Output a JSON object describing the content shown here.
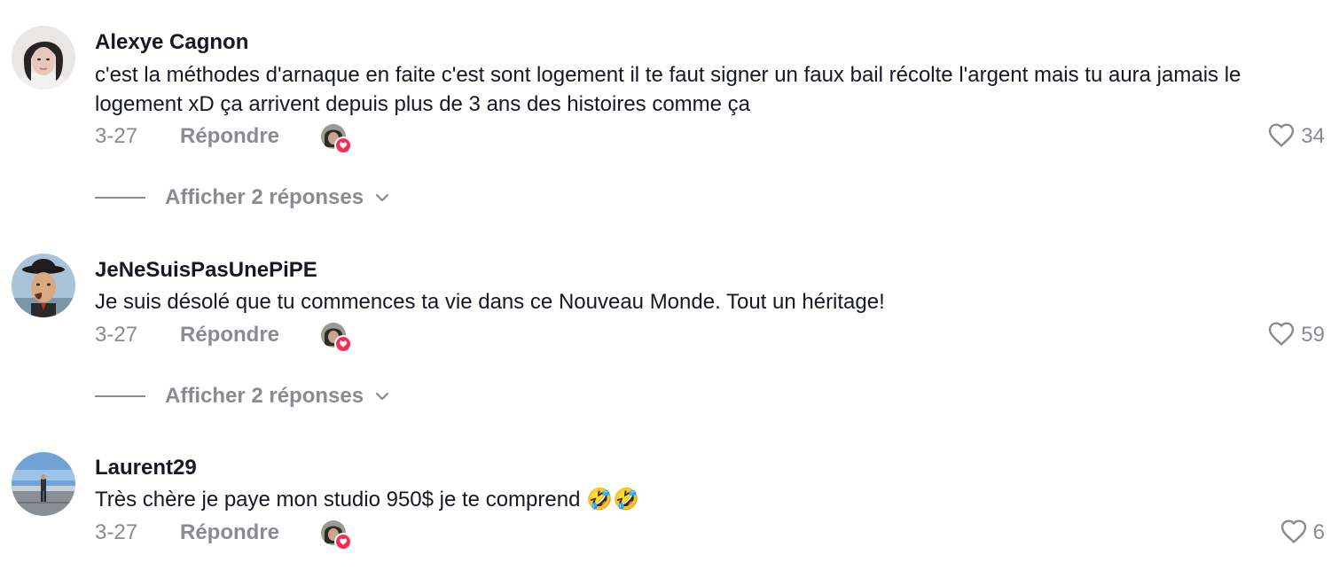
{
  "comments": [
    {
      "username": "Alexye Cagnon",
      "text": "c'est la méthodes d'arnaque en faite c'est sont logement il te faut signer un faux bail récolte l'argent mais tu aura jamais le logement xD ça arrivent depuis plus de 3 ans des histoires comme ça",
      "date": "3-27",
      "reply_label": "Répondre",
      "likes": "34",
      "view_replies": "Afficher 2 réponses"
    },
    {
      "username": "JeNeSuisPasUnePiPE",
      "text": "Je suis désolé que tu commences ta vie dans ce Nouveau Monde. Tout un héritage!",
      "date": "3-27",
      "reply_label": "Répondre",
      "likes": "59",
      "view_replies": "Afficher 2 réponses"
    },
    {
      "username": "Laurent29",
      "text": "Très chère je paye mon studio 950$ je te comprend 🤣🤣",
      "date": "3-27",
      "reply_label": "Répondre",
      "likes": "6"
    }
  ],
  "icons": {
    "like": "heart-outline-icon",
    "creator_liked": "creator-liked-badge",
    "expand": "chevron-down-icon"
  },
  "colors": {
    "text": "#161823",
    "muted": "#8a8b91",
    "accent": "#fe2c55"
  }
}
